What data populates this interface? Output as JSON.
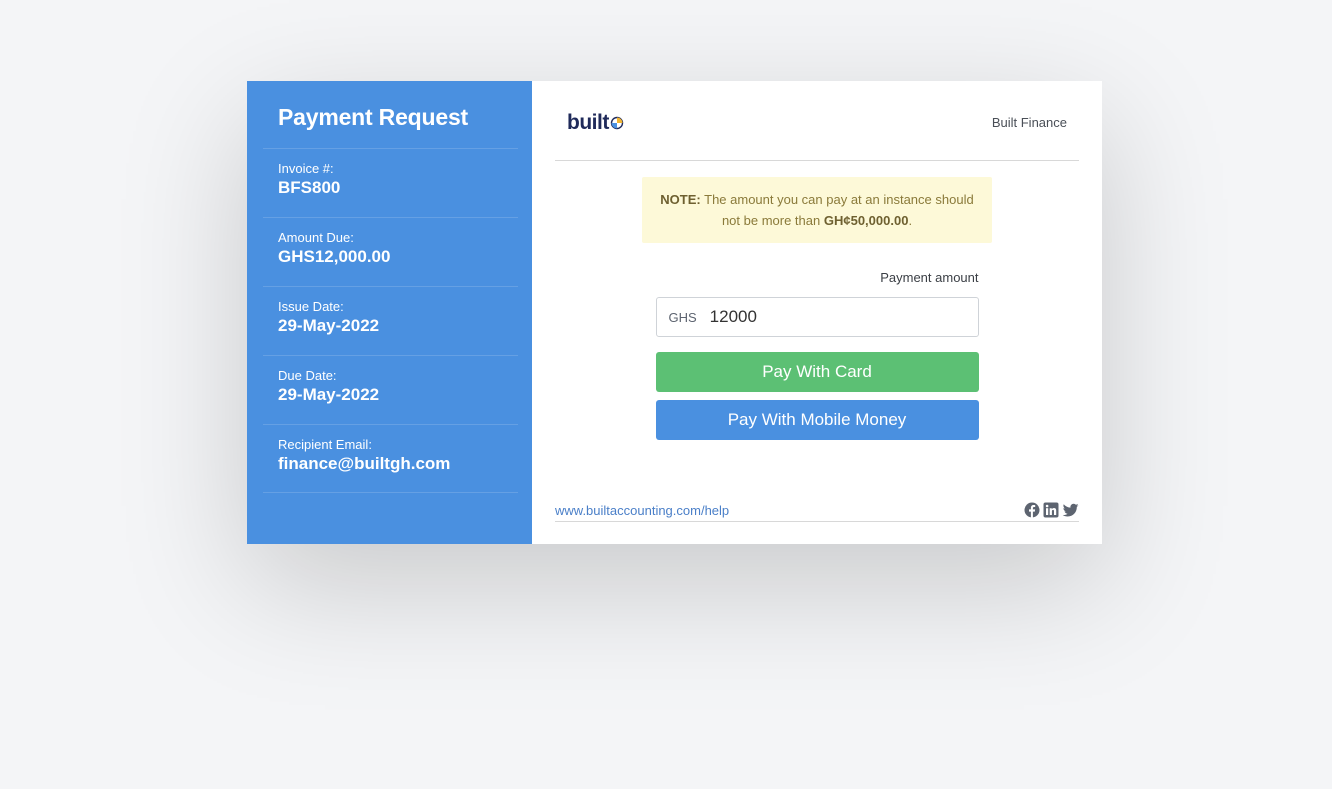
{
  "sidebar": {
    "title": "Payment Request",
    "items": [
      {
        "label": "Invoice #:",
        "value": "BFS800"
      },
      {
        "label": "Amount Due:",
        "value": "GHS12,000.00"
      },
      {
        "label": "Issue Date:",
        "value": "29-May-2022"
      },
      {
        "label": "Due Date:",
        "value": "29-May-2022"
      },
      {
        "label": "Recipient Email:",
        "value": "finance@builtgh.com"
      }
    ]
  },
  "header": {
    "logo_text": "built",
    "company": "Built Finance"
  },
  "note": {
    "prefix": "NOTE:",
    "text": "The amount you can pay at an instance should not be more than",
    "limit": "GH¢50,000.00",
    "suffix": "."
  },
  "form": {
    "amount_label": "Payment amount",
    "currency": "GHS",
    "amount_value": "12000",
    "pay_card_label": "Pay With Card",
    "pay_momo_label": "Pay With Mobile Money"
  },
  "footer": {
    "help_link": "www.builtaccounting.com/help",
    "social_icons": [
      "facebook-icon",
      "linkedin-icon",
      "twitter-icon"
    ]
  },
  "colors": {
    "sidebar": "#4a90e0",
    "card_button": "#5cc074",
    "momo_button": "#4a90e0",
    "note_bg": "#fdf9d8"
  }
}
